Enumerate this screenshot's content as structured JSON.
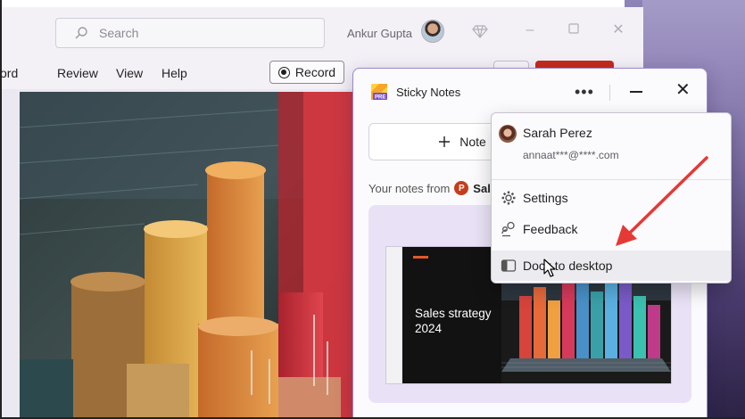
{
  "powerpoint": {
    "search_placeholder": "Search",
    "user_name": "Ankur Gupta",
    "ribbon_tabs": [
      "ord",
      "Review",
      "View",
      "Help"
    ],
    "record_label": "Record"
  },
  "sticky_notes": {
    "title": "Sticky Notes",
    "logo_text": "PRE",
    "new_note_label": "Note",
    "your_notes_prefix": "Your notes from",
    "your_notes_app_icon": "P",
    "your_notes_source": "Sal",
    "slide_title": "Sales strategy",
    "slide_year": "2024"
  },
  "account_menu": {
    "name": "Sarah Perez",
    "email": "annaat***@****.com",
    "items": [
      {
        "label": "Settings",
        "icon": "gear-icon"
      },
      {
        "label": "Feedback",
        "icon": "feedback-icon"
      },
      {
        "label": "Dock to desktop",
        "icon": "dock-icon"
      }
    ]
  },
  "colors": {
    "accent_red": "#e53935",
    "sticky_border": "#9a89c8",
    "ppt_red": "#c43e1c"
  }
}
